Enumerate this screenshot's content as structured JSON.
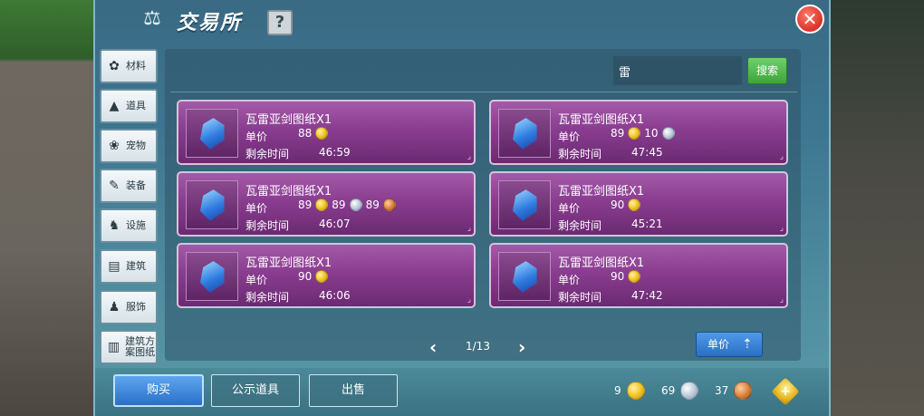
{
  "header": {
    "title": "交易所",
    "help_label": "?",
    "close_label": "✕"
  },
  "sidebar": {
    "items": [
      {
        "label": "材料",
        "icon": "cotton-icon"
      },
      {
        "label": "道具",
        "icon": "potion-icon"
      },
      {
        "label": "宠物",
        "icon": "paw-icon"
      },
      {
        "label": "装备",
        "icon": "sword-icon"
      },
      {
        "label": "设施",
        "icon": "horse-icon"
      },
      {
        "label": "建筑",
        "icon": "brick-icon"
      },
      {
        "label": "服饰",
        "icon": "shirt-icon"
      },
      {
        "label": "建筑方案图纸",
        "icon": "blueprint-icon"
      }
    ]
  },
  "search": {
    "value": "雷",
    "button_label": "搜索"
  },
  "labels": {
    "price": "单价",
    "time_left": "剩余时间"
  },
  "listings": [
    {
      "name": "瓦雷亚剑图纸X1",
      "prices": [
        {
          "amount": "88",
          "coin": "gold"
        }
      ],
      "time": "46:59"
    },
    {
      "name": "瓦雷亚剑图纸X1",
      "prices": [
        {
          "amount": "89",
          "coin": "gold"
        },
        {
          "amount": "10",
          "coin": "silver"
        }
      ],
      "time": "47:45"
    },
    {
      "name": "瓦雷亚剑图纸X1",
      "prices": [
        {
          "amount": "89",
          "coin": "gold"
        },
        {
          "amount": "89",
          "coin": "silver"
        },
        {
          "amount": "89",
          "coin": "bronze"
        }
      ],
      "time": "46:07"
    },
    {
      "name": "瓦雷亚剑图纸X1",
      "prices": [
        {
          "amount": "90",
          "coin": "gold"
        }
      ],
      "time": "45:21"
    },
    {
      "name": "瓦雷亚剑图纸X1",
      "prices": [
        {
          "amount": "90",
          "coin": "gold"
        }
      ],
      "time": "46:06"
    },
    {
      "name": "瓦雷亚剑图纸X1",
      "prices": [
        {
          "amount": "90",
          "coin": "gold"
        }
      ],
      "time": "47:42"
    }
  ],
  "pagination": {
    "page": "1/13",
    "prev": "‹",
    "next": "›"
  },
  "sort": {
    "label": "单价"
  },
  "bottom": {
    "buy_label": "购买",
    "public_label": "公示道具",
    "sell_label": "出售"
  },
  "wallet": {
    "gold": "9",
    "silver": "69",
    "bronze": "37"
  },
  "colors": {
    "gold": "#f0c020",
    "silver": "#b8c8d8",
    "bronze": "#d7803a",
    "card": "#8a3d90"
  }
}
